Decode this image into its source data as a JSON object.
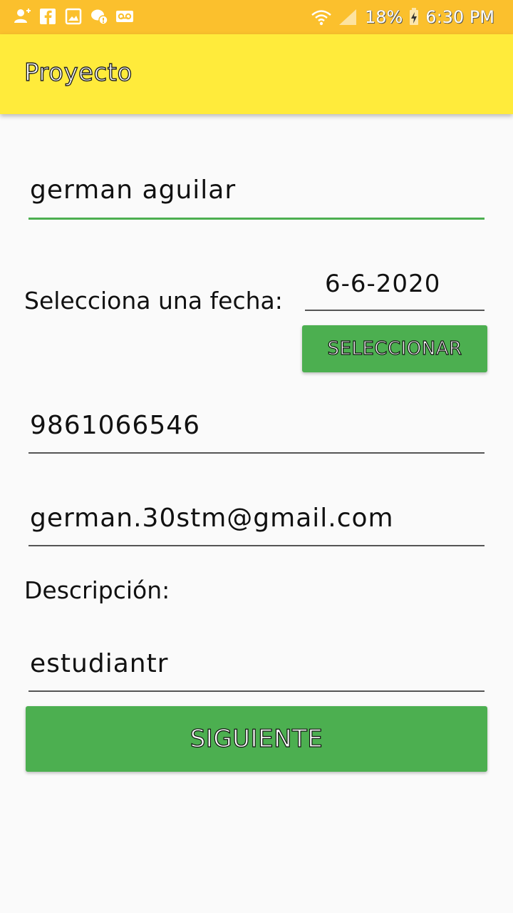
{
  "status_bar": {
    "battery": "18%",
    "time": "6:30 PM",
    "icons": [
      "add-contact-icon",
      "facebook-icon",
      "gallery-icon",
      "chat-icon",
      "voicemail-icon",
      "wifi-icon",
      "signal-icon",
      "battery-charging-icon"
    ]
  },
  "app_bar": {
    "title": "Proyecto"
  },
  "form": {
    "name_value": "german aguilar",
    "date_label": "Selecciona una fecha:",
    "date_value": "6-6-2020",
    "select_button": "SELECCIONAR",
    "phone_value": "9861066546",
    "email_value": "german.30stm@gmail.com",
    "description_label": "Descripción:",
    "description_value": "estudiantr",
    "next_button": "SIGUIENTE"
  },
  "colors": {
    "status_bar": "#fbc02d",
    "app_bar": "#ffeb3b",
    "accent": "#4caf50",
    "background": "#fafafa"
  }
}
